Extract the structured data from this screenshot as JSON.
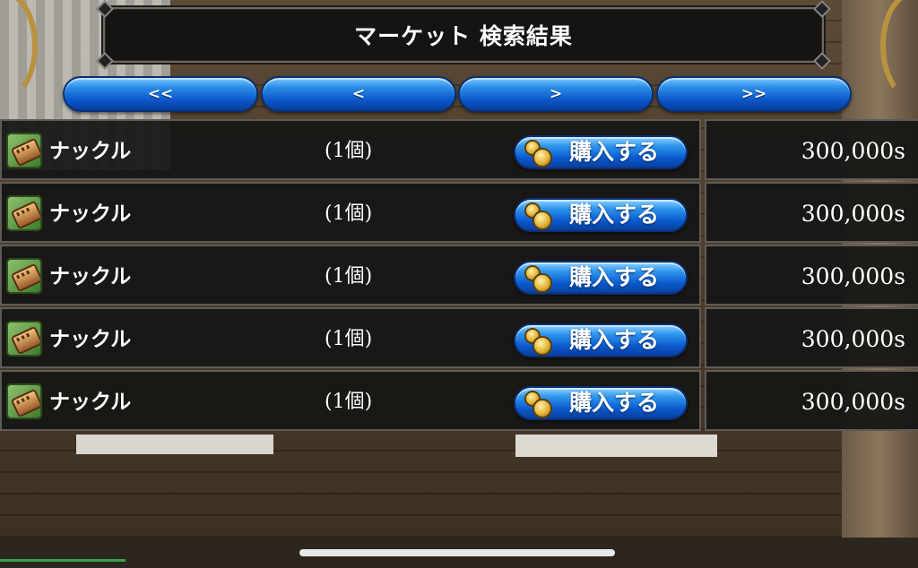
{
  "title": "マーケット 検索結果",
  "pagination": {
    "first": "<<",
    "prev": "<",
    "next": ">",
    "last": ">>"
  },
  "items": [
    {
      "name": "ナックル",
      "quantity": "(1個)",
      "buy_label": "購入する",
      "price": "300,000s",
      "icon": "knuckle-icon"
    },
    {
      "name": "ナックル",
      "quantity": "(1個)",
      "buy_label": "購入する",
      "price": "300,000s",
      "icon": "knuckle-icon"
    },
    {
      "name": "ナックル",
      "quantity": "(1個)",
      "buy_label": "購入する",
      "price": "300,000s",
      "icon": "knuckle-icon"
    },
    {
      "name": "ナックル",
      "quantity": "(1個)",
      "buy_label": "購入する",
      "price": "300,000s",
      "icon": "knuckle-icon"
    },
    {
      "name": "ナックル",
      "quantity": "(1個)",
      "buy_label": "購入する",
      "price": "300,000s",
      "icon": "knuckle-icon"
    }
  ],
  "colors": {
    "button_blue": "#0a58cc",
    "panel_bg": "#161514",
    "panel_border": "#5f5b56"
  }
}
